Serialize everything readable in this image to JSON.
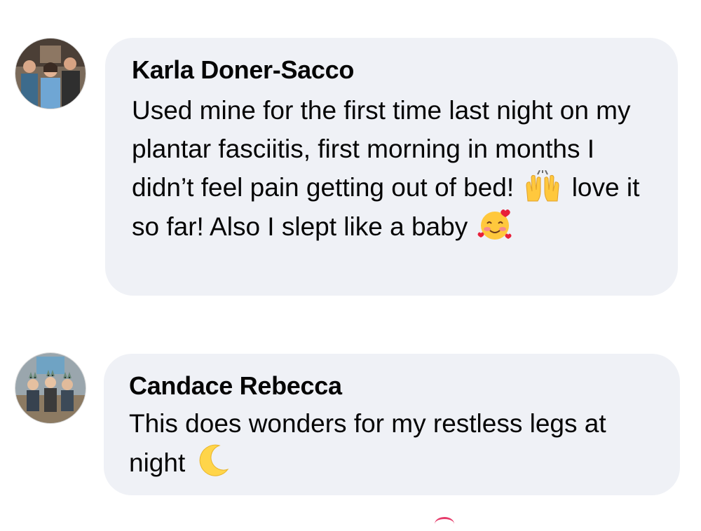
{
  "comments": [
    {
      "author": "Karla Doner-Sacco",
      "text_part1": "Used mine for the first time last night on my plantar fasciitis, first morning in months I didn’t feel pain getting out of bed!",
      "emoji1": "raising-hands-emoji",
      "text_part2": "love it so far! Also I slept like a baby",
      "emoji2": "smiling-face-with-hearts-emoji"
    },
    {
      "author": "Candace Rebecca",
      "text_part1": "This does wonders for my restless legs at night",
      "emoji1": "crescent-moon-emoji"
    }
  ],
  "colors": {
    "bubble": "#eff1f6",
    "text": "#050505",
    "emoji_yellow": "#ffc83d"
  }
}
